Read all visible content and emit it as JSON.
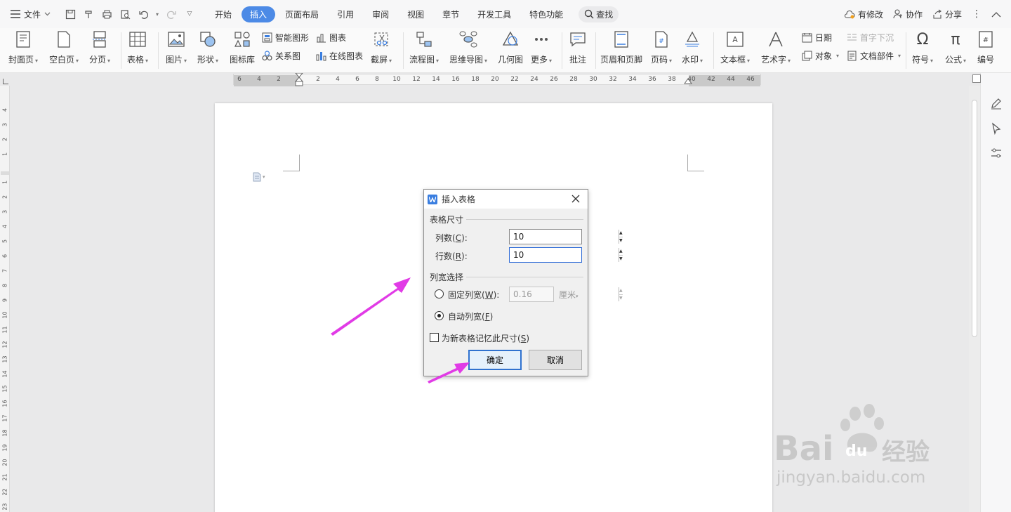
{
  "menubar": {
    "file": "文件",
    "tabs": [
      "开始",
      "插入",
      "页面布局",
      "引用",
      "审阅",
      "视图",
      "章节",
      "开发工具",
      "特色功能"
    ],
    "active_tab": "插入",
    "search": "查找",
    "right": {
      "modified": "有修改",
      "collab": "协作",
      "share": "分享"
    }
  },
  "ribbon": {
    "cover": "封面页",
    "blank": "空白页",
    "pagebreak": "分页",
    "table": "表格",
    "picture": "图片",
    "shape": "形状",
    "iconlib": "图标库",
    "smartart": "智能图形",
    "chart": "图表",
    "relation": "关系图",
    "onlinechart": "在线图表",
    "screenshot": "截屏",
    "flowchart": "流程图",
    "mindmap": "思维导图",
    "geometry": "几何图",
    "more": "更多",
    "comment": "批注",
    "headerfooter": "页眉和页脚",
    "pagenum": "页码",
    "watermark": "水印",
    "textbox": "文本框",
    "wordart": "艺术字",
    "date": "日期",
    "object": "对象",
    "dropcap": "首字下沉",
    "docparts": "文档部件",
    "symbol": "符号",
    "formula": "公式",
    "numbering": "编号"
  },
  "ruler": {
    "top_ticks": [
      "6",
      "4",
      "2",
      "2",
      "4",
      "6",
      "8",
      "10",
      "12",
      "14",
      "16",
      "18",
      "20",
      "22",
      "24",
      "26",
      "28",
      "30",
      "32",
      "34",
      "36",
      "38",
      "40",
      "42",
      "44",
      "46"
    ],
    "side_ticks": [
      "4",
      "3",
      "2",
      "1",
      "1",
      "2",
      "3",
      "4",
      "5",
      "6",
      "7",
      "8",
      "9",
      "10",
      "11",
      "12",
      "13",
      "14",
      "15",
      "16",
      "17",
      "18",
      "19",
      "20",
      "21",
      "22",
      "23"
    ]
  },
  "dialog": {
    "title": "插入表格",
    "size_group": "表格尺寸",
    "cols_label": "列数(",
    "cols_key": "C",
    "cols_label_end": "):",
    "cols_value": "10",
    "rows_label": "行数(",
    "rows_key": "R",
    "rows_label_end": "):",
    "rows_value": "10",
    "width_group": "列宽选择",
    "fixed_label": "固定列宽(",
    "fixed_key": "W",
    "fixed_label_end": "):",
    "fixed_value": "0.16",
    "unit": "厘米",
    "auto_label": "自动列宽(",
    "auto_key": "F",
    "auto_label_end": ")",
    "auto_selected": true,
    "remember_label": "为新表格记忆此尺寸(",
    "remember_key": "S",
    "remember_label_end": ")",
    "remember_checked": false,
    "ok": "确定",
    "cancel": "取消"
  },
  "watermark": {
    "brand": "Bai",
    "brand2": "du",
    "cn": "经验",
    "url": "jingyan.baidu.com"
  },
  "colors": {
    "accent": "#4c8ae6",
    "arrow": "#e13be6",
    "watermark": "#c8c8c8"
  }
}
